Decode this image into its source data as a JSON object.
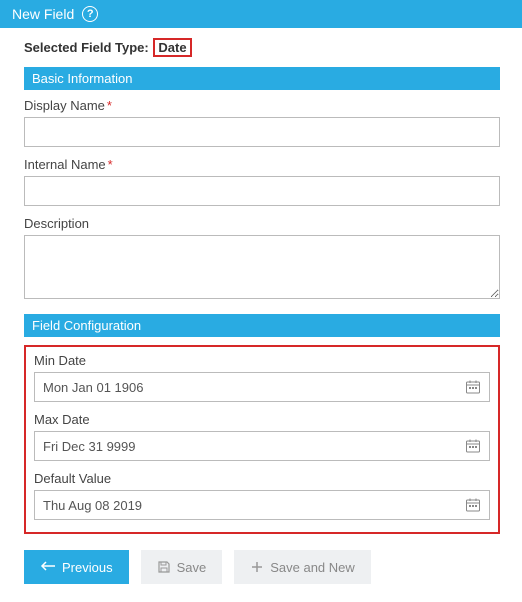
{
  "topbar": {
    "title": "New Field"
  },
  "selected": {
    "label": "Selected Field Type:",
    "value": "Date"
  },
  "sections": {
    "basic": {
      "header": "Basic Information",
      "displayName": {
        "label": "Display Name",
        "required": "*",
        "value": ""
      },
      "internalName": {
        "label": "Internal Name",
        "required": "*",
        "value": ""
      },
      "description": {
        "label": "Description",
        "value": ""
      }
    },
    "config": {
      "header": "Field Configuration",
      "minDate": {
        "label": "Min Date",
        "value": "Mon Jan 01 1906"
      },
      "maxDate": {
        "label": "Max Date",
        "value": "Fri Dec 31 9999"
      },
      "defaultValue": {
        "label": "Default Value",
        "value": "Thu Aug 08 2019"
      }
    }
  },
  "buttons": {
    "previous": "Previous",
    "save": "Save",
    "saveAndNew": "Save and New"
  }
}
